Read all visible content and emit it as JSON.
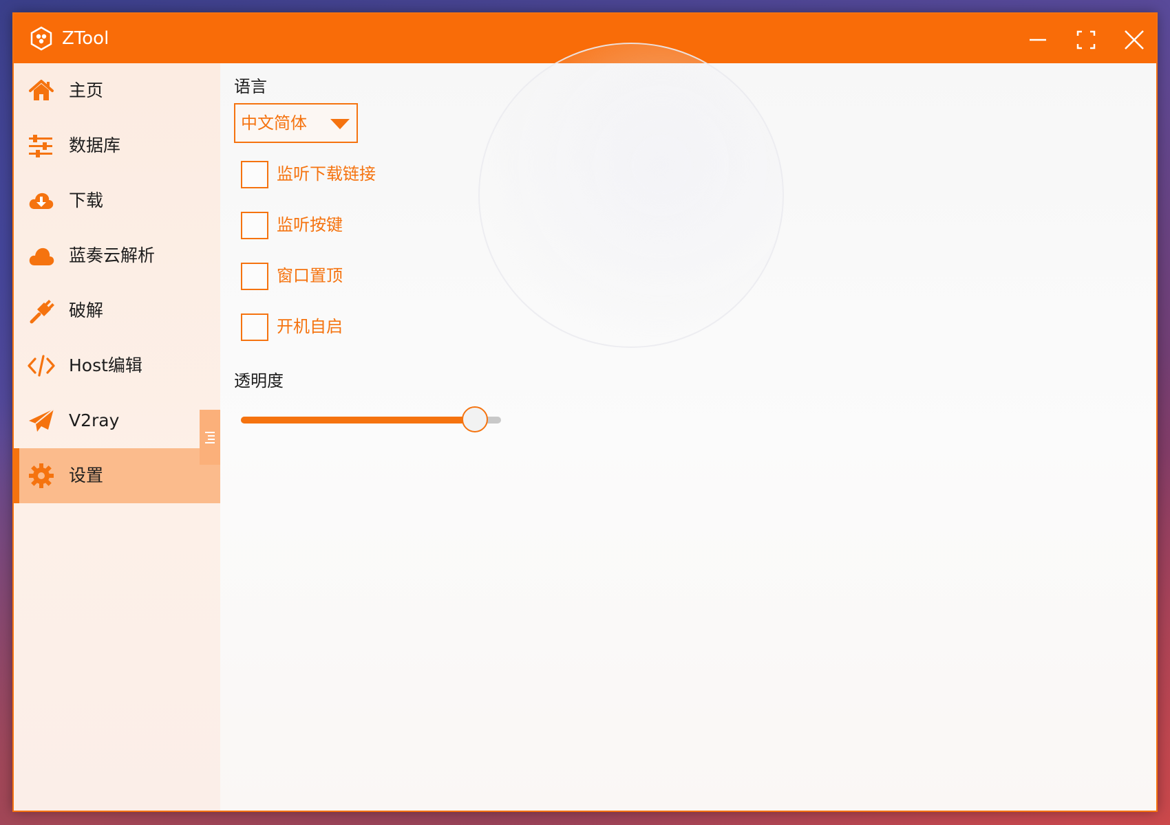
{
  "window": {
    "title": "ZTool",
    "accent_color": "#f96c08"
  },
  "titlebar": {
    "logo_icon": "ztool-logo-icon",
    "minimize_icon": "minimize-icon",
    "maximize_icon": "fullscreen-icon",
    "close_icon": "close-icon"
  },
  "sidebar": {
    "items": [
      {
        "label": "主页",
        "icon": "home-icon",
        "active": false
      },
      {
        "label": "数据库",
        "icon": "sliders-icon",
        "active": false
      },
      {
        "label": "下载",
        "icon": "cloud-download-icon",
        "active": false
      },
      {
        "label": "蓝奏云解析",
        "icon": "cloud-icon",
        "active": false
      },
      {
        "label": "破解",
        "icon": "plug-icon",
        "active": false
      },
      {
        "label": "Host编辑",
        "icon": "code-icon",
        "active": false
      },
      {
        "label": "V2ray",
        "icon": "paper-plane-icon",
        "active": false
      },
      {
        "label": "设置",
        "icon": "gear-icon",
        "active": true
      }
    ],
    "collapse_icon": "collapse-list-icon"
  },
  "settings": {
    "language_label": "语言",
    "language_value": "中文简体",
    "checkboxes": [
      {
        "label": "监听下载链接",
        "checked": false
      },
      {
        "label": "监听按键",
        "checked": false
      },
      {
        "label": "窗口置顶",
        "checked": false
      },
      {
        "label": "开机自启",
        "checked": false
      }
    ],
    "opacity_label": "透明度",
    "opacity_value": 0.9
  }
}
